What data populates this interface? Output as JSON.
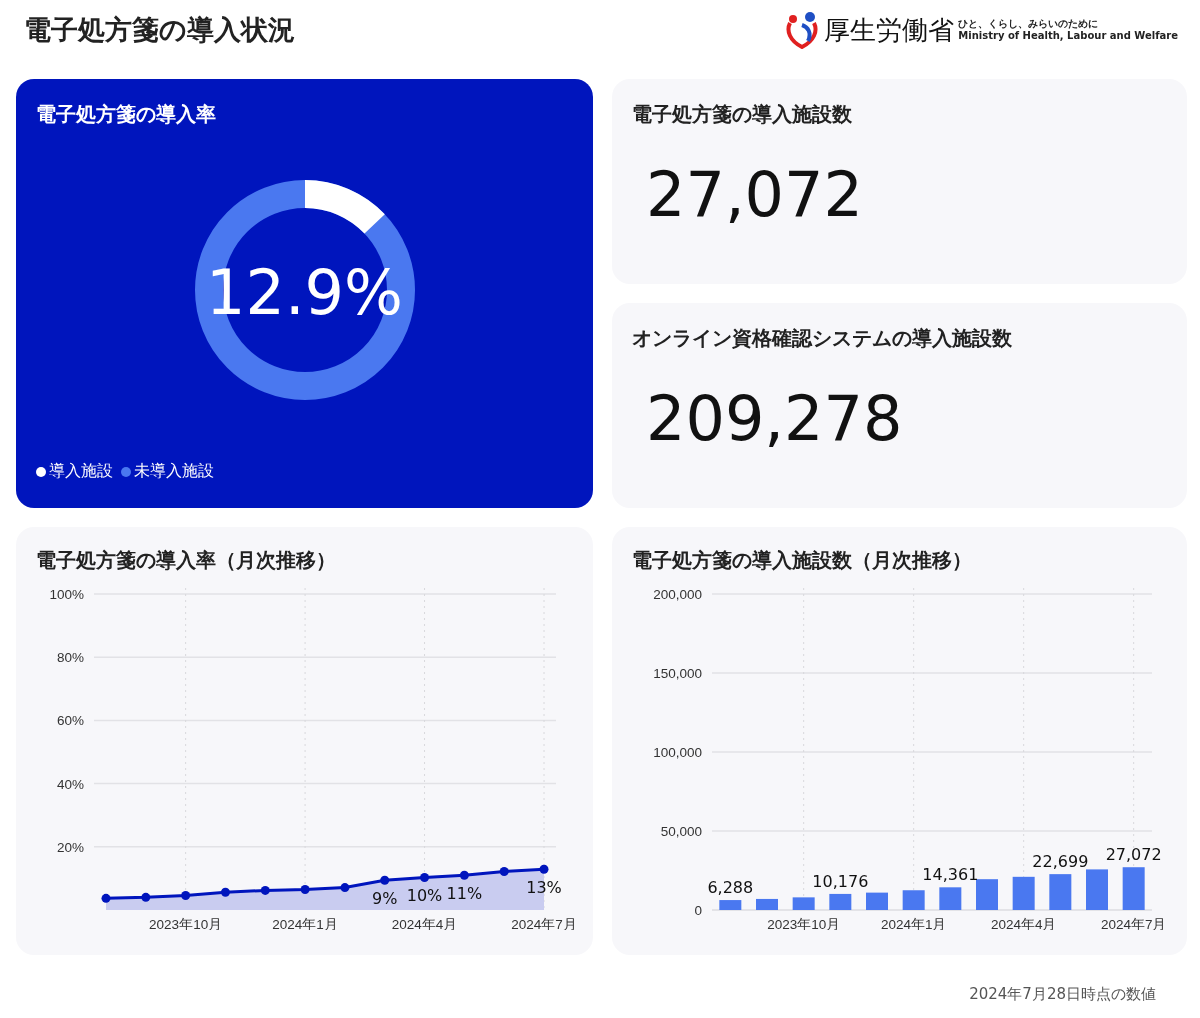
{
  "header": {
    "title": "電子処方箋の導入状況",
    "logo": {
      "name": "厚生労働省",
      "tagline": "ひと、くらし、みらいのために",
      "english": "Ministry of Health, Labour and Welfare"
    }
  },
  "rate_card": {
    "title": "電子処方箋の導入率",
    "level": 0.129,
    "value": "12.9%",
    "legend": [
      {
        "label": "導入施設",
        "color": "#ffffff"
      },
      {
        "label": "未導入施設",
        "color": "#4a78f0"
      }
    ]
  },
  "stat_cards": [
    {
      "title": "電子処方箋の導入施設数",
      "value": "27,072"
    },
    {
      "title": "オンライン資格確認システムの導入施設数",
      "value": "209,278"
    }
  ],
  "charts": [
    {
      "title": "電子処方箋の導入率（月次推移）",
      "chart_data": {
        "type": "area",
        "categories": [
          null,
          null,
          "2023年10月",
          null,
          null,
          "2024年1月",
          null,
          null,
          "2024年4月",
          null,
          null,
          "2024年7月"
        ],
        "series": [
          {
            "color": "#0015bd",
            "values": [
              3.7,
              4.0,
              4.6,
              5.6,
              6.2,
              6.5,
              7.1,
              9.4,
              10.3,
              11.0,
              12.2,
              12.9
            ]
          }
        ],
        "grid": true,
        "ylim": [
          0,
          100
        ],
        "yticks": [
          {
            "value": 20,
            "label": "20%"
          },
          {
            "value": 40,
            "label": "40%"
          },
          {
            "value": 60,
            "label": "60%"
          },
          {
            "value": 80,
            "label": "80%"
          },
          {
            "value": 100,
            "label": "100%"
          }
        ],
        "value_labels": [
          null,
          null,
          null,
          null,
          null,
          null,
          null,
          "9%",
          "10%",
          "11%",
          null,
          "13%"
        ]
      }
    },
    {
      "title": "電子処方箋の導入施設数（月次推移）",
      "chart_data": {
        "type": "bar",
        "categories": [
          null,
          null,
          "2023年10月",
          null,
          null,
          "2024年1月",
          null,
          null,
          "2024年4月",
          null,
          null,
          "2024年7月"
        ],
        "series": [
          {
            "color": "#4a78f0",
            "values": [
              6288,
              7000,
              8000,
              10176,
              11000,
              12500,
              14361,
              19500,
              21000,
              22699,
              25700,
              27072
            ]
          }
        ],
        "grid": true,
        "ylim": [
          0,
          200000
        ],
        "yticks": [
          {
            "value": 0,
            "label": "0"
          },
          {
            "value": 50000,
            "label": "50,000"
          },
          {
            "value": 100000,
            "label": "100,000"
          },
          {
            "value": 150000,
            "label": "150,000"
          },
          {
            "value": 200000,
            "label": "200,000"
          }
        ],
        "value_labels": [
          "6,288",
          null,
          null,
          "10,176",
          null,
          null,
          "14,361",
          null,
          null,
          "22,699",
          null,
          "27,072"
        ]
      }
    }
  ],
  "footer": "2024年7月28日時点の数値"
}
